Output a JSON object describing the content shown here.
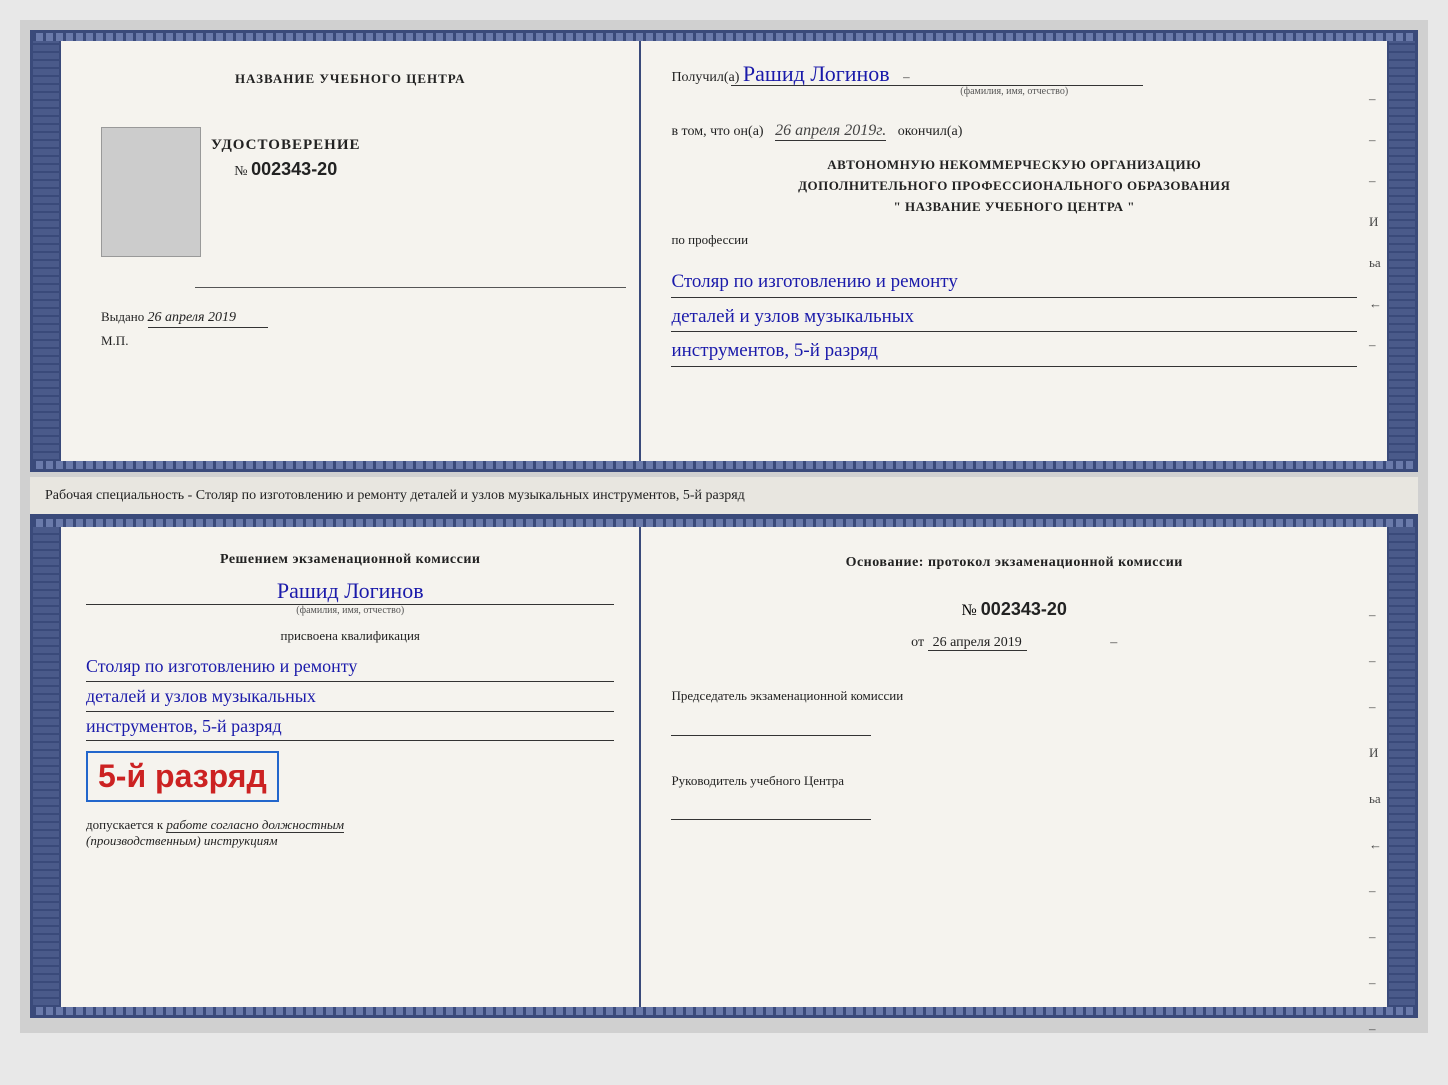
{
  "page": {
    "background_color": "#d4d0cc"
  },
  "top_certificate": {
    "left_panel": {
      "school_name": "НАЗВАНИЕ УЧЕБНОГО ЦЕНТРА",
      "udostoverenie_label": "УДОСТОВЕРЕНИЕ",
      "number_prefix": "№",
      "number": "002343-20",
      "vydano_label": "Выдано",
      "vydano_date": "26 апреля 2019",
      "mp_label": "М.П."
    },
    "right_panel": {
      "poluchil_label": "Получил(а)",
      "recipient_name": "Рашид Логинов",
      "fio_subtitle": "(фамилия, имя, отчество)",
      "vtom_label": "в том, что он(а)",
      "completion_date": "26 апреля 2019г.",
      "okonchil_label": "окончил(а)",
      "org_line1": "АВТОНОМНУЮ НЕКОММЕРЧЕСКУЮ ОРГАНИЗАЦИЮ",
      "org_line2": "ДОПОЛНИТЕЛЬНОГО ПРОФЕССИОНАЛЬНОГО ОБРАЗОВАНИЯ",
      "org_line3": "\"  НАЗВАНИЕ УЧЕБНОГО ЦЕНТРА  \"",
      "po_professii_label": "по профессии",
      "profession_line1": "Столяр по изготовлению и ремонту",
      "profession_line2": "деталей и узлов музыкальных",
      "profession_line3": "инструментов, 5-й разряд"
    }
  },
  "specialty_text": {
    "label": "Рабочая специальность - Столяр по изготовлению и ремонту деталей и узлов музыкальных инструментов, 5-й разряд"
  },
  "bottom_certificate": {
    "left_panel": {
      "resheniem_label": "Решением экзаменационной комиссии",
      "recipient_name": "Рашид Логинов",
      "fio_subtitle": "(фамилия, имя, отчество)",
      "prisvoena_label": "присвоена квалификация",
      "qualification_line1": "Столяр по изготовлению и ремонту",
      "qualification_line2": "деталей и узлов музыкальных",
      "qualification_line3": "инструментов, 5-й разряд",
      "razryad_display": "5-й разряд",
      "dopuskaetsya_prefix": "допускается к",
      "dopuskaetsya_text": "работе согласно должностным",
      "dopuskaetsya_text2": "(производственным) инструкциям"
    },
    "right_panel": {
      "osnovanie_label": "Основание: протокол экзаменационной комиссии",
      "number_prefix": "№",
      "number": "002343-20",
      "ot_prefix": "от",
      "ot_date": "26 апреля 2019",
      "predsedatel_label": "Председатель экзаменационной комиссии",
      "rukovoditel_label": "Руководитель учебного Центра"
    }
  },
  "decorative": {
    "right_marks_top": [
      "–",
      "–",
      "–",
      "И",
      "ьа",
      "←",
      "–"
    ],
    "right_marks_bottom": [
      "–",
      "–",
      "–",
      "И",
      "ьа",
      "←",
      "–",
      "–",
      "–",
      "–"
    ]
  }
}
